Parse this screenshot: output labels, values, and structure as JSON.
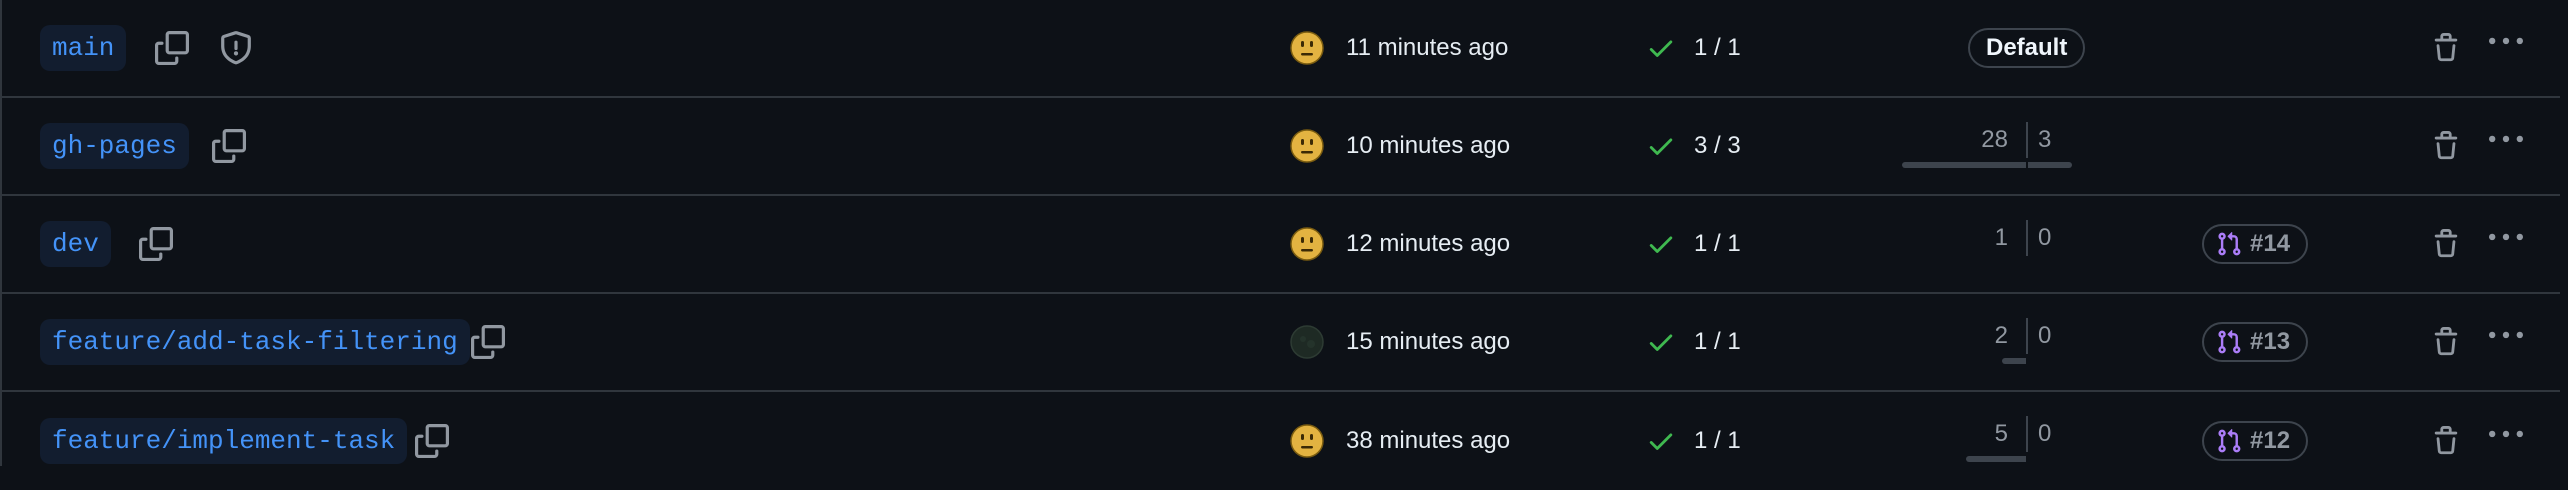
{
  "colors": {
    "background": "#0d1117",
    "border": "#30363d",
    "branch_text": "#4493f8",
    "branch_bg": "#121d2f",
    "check_green": "#3fb950",
    "pr_icon_purple": "#ab7df8",
    "muted": "#9198a1"
  },
  "branches": [
    {
      "name": "main",
      "icons": [
        "copy-icon",
        "shield-icon"
      ],
      "avatar": "emoji-avatar",
      "updated": "11 minutes ago",
      "checks": "1 / 1",
      "default_badge": "Default",
      "behind": "",
      "ahead": "",
      "pr": ""
    },
    {
      "name": "gh-pages",
      "icons": [
        "copy-icon"
      ],
      "avatar": "emoji-avatar",
      "updated": "10 minutes ago",
      "checks": "3 / 3",
      "default_badge": "",
      "behind": "28",
      "ahead": "3",
      "pr": ""
    },
    {
      "name": "dev",
      "icons": [
        "copy-icon"
      ],
      "avatar": "emoji-avatar",
      "updated": "12 minutes ago",
      "checks": "1 / 1",
      "default_badge": "",
      "behind": "1",
      "ahead": "0",
      "pr": "#14"
    },
    {
      "name": "feature/add-task-filtering",
      "icons": [
        "copy-icon"
      ],
      "avatar": "dark-avatar",
      "updated": "15 minutes ago",
      "checks": "1 / 1",
      "default_badge": "",
      "behind": "2",
      "ahead": "0",
      "pr": "#13"
    },
    {
      "name": "feature/implement-task",
      "icons": [
        "copy-icon"
      ],
      "avatar": "emoji-avatar",
      "updated": "38 minutes ago",
      "checks": "1 / 1",
      "default_badge": "",
      "behind": "5",
      "ahead": "0",
      "pr": "#12"
    }
  ]
}
